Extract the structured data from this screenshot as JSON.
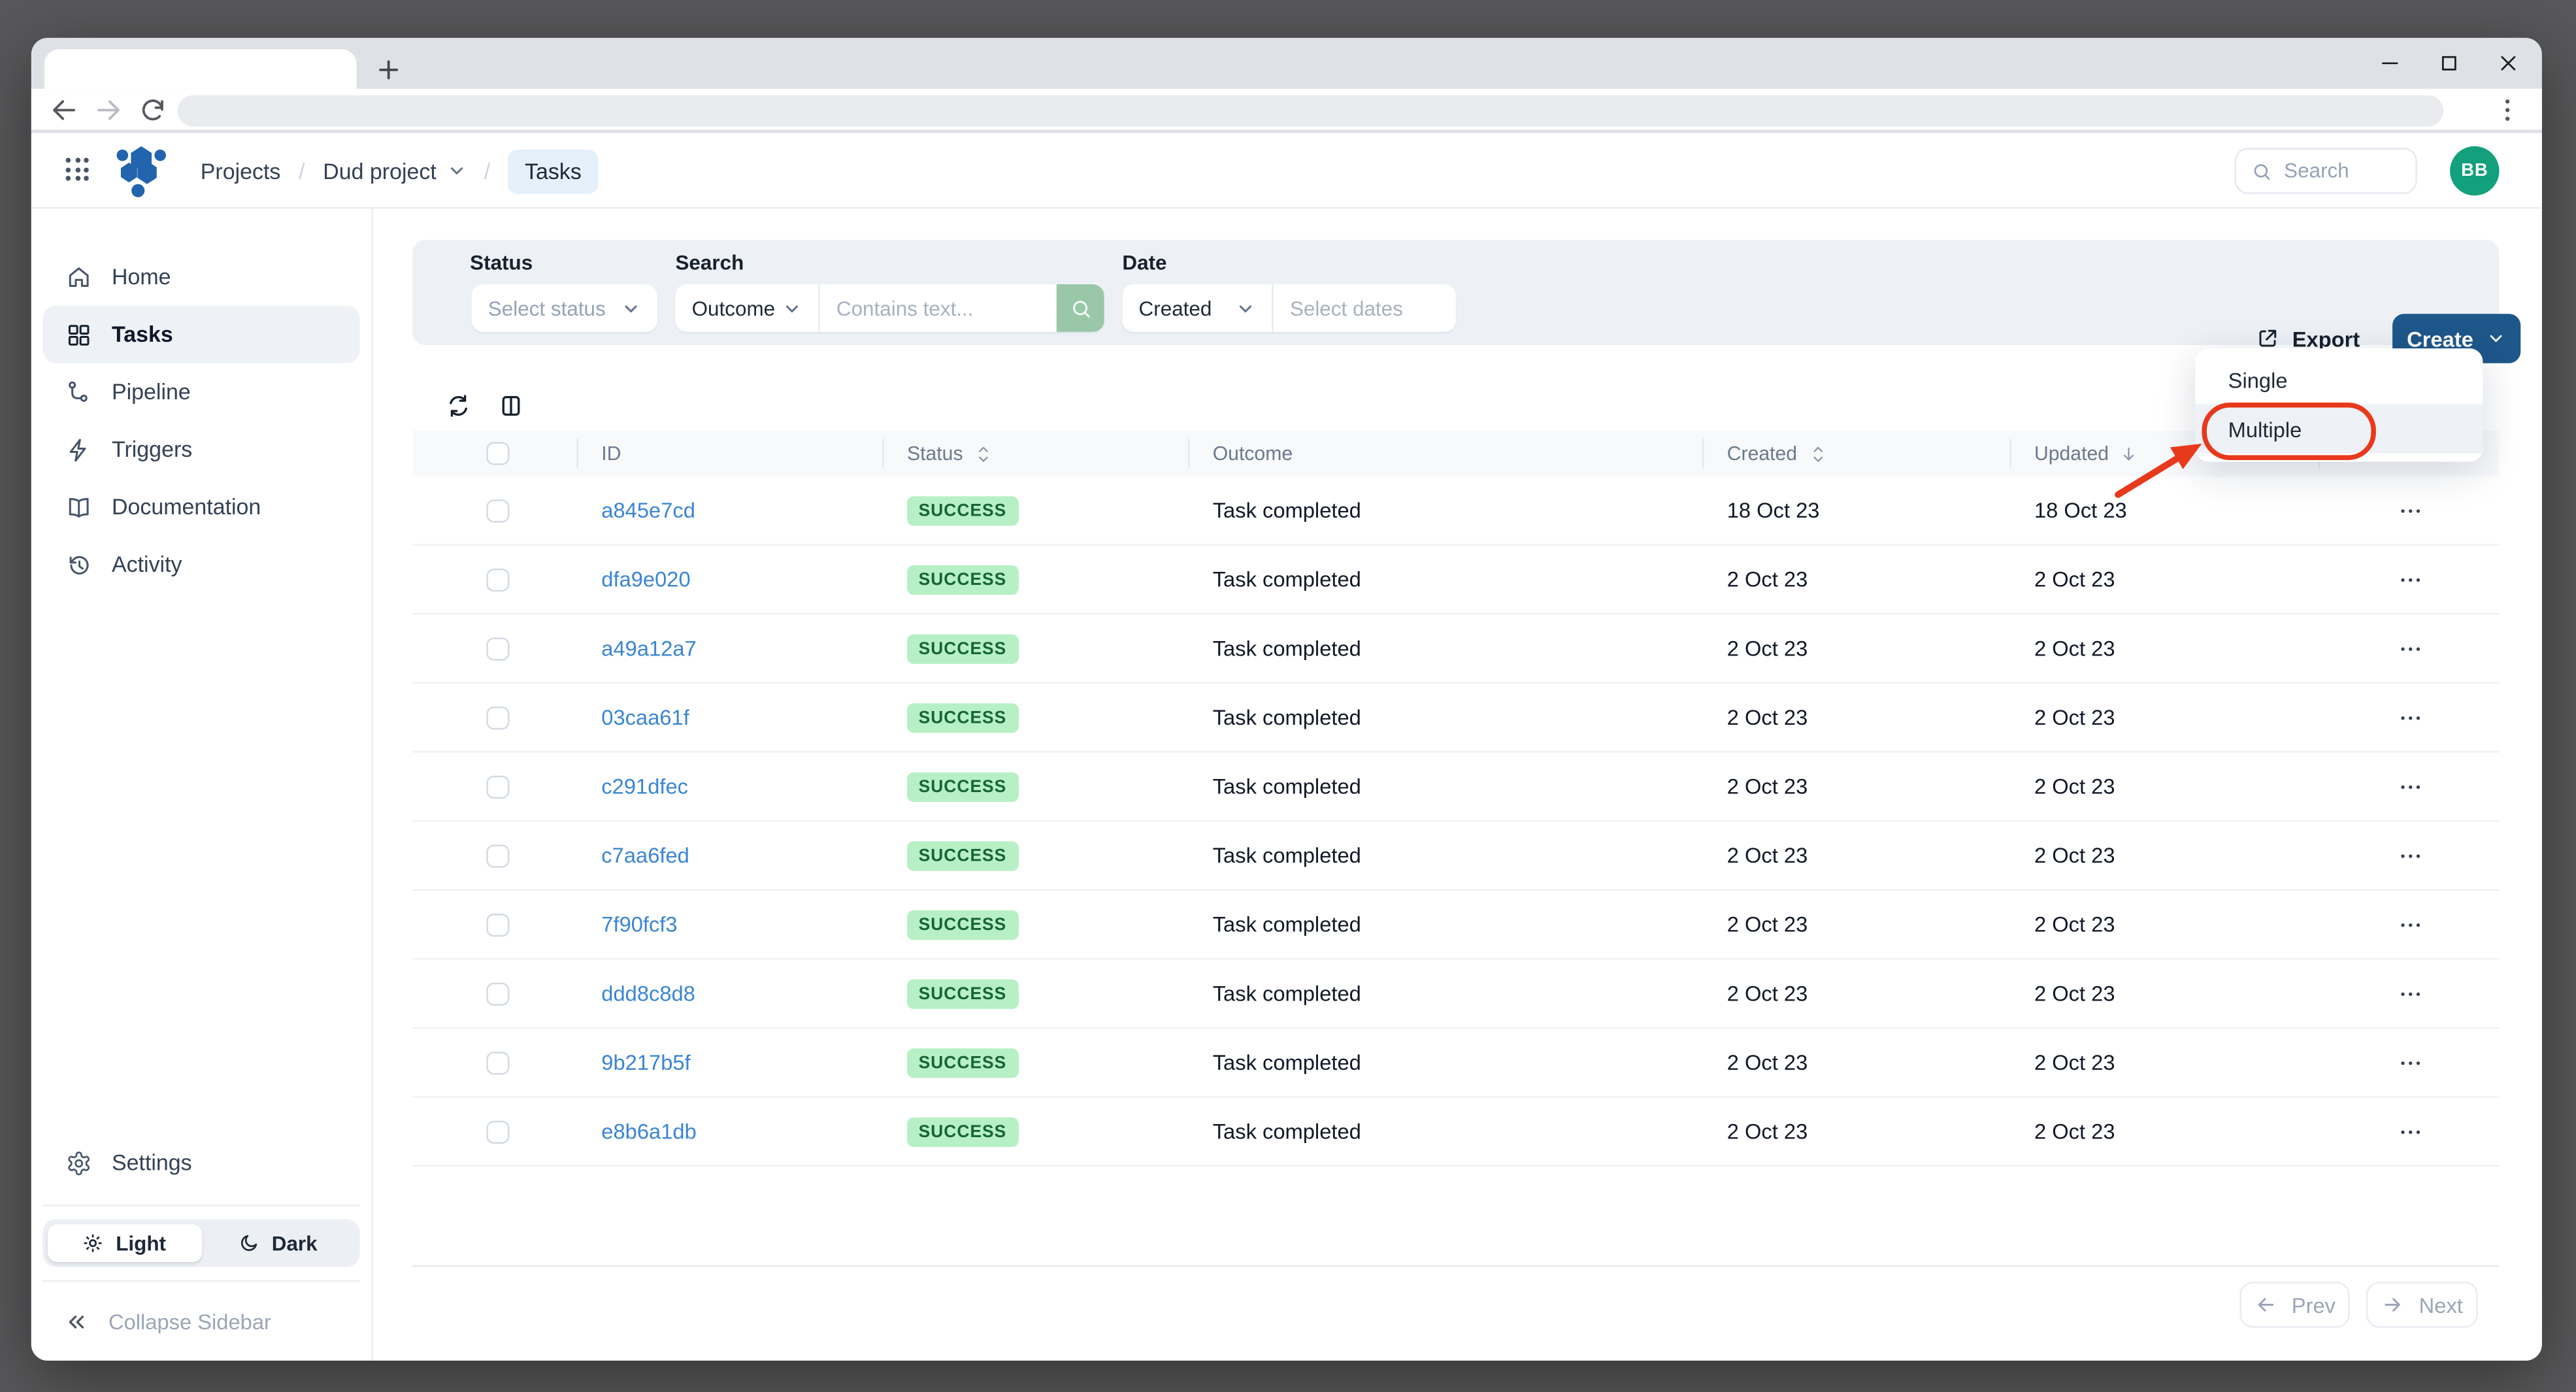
{
  "header": {
    "breadcrumb": {
      "items": [
        "Projects",
        "Dud project",
        "Tasks"
      ],
      "separator": "/"
    },
    "search_placeholder": "Search",
    "avatar_initials": "BB"
  },
  "sidebar": {
    "items": [
      {
        "label": "Home"
      },
      {
        "label": "Tasks"
      },
      {
        "label": "Pipeline"
      },
      {
        "label": "Triggers"
      },
      {
        "label": "Documentation"
      },
      {
        "label": "Activity"
      }
    ],
    "active_item": "Tasks",
    "settings_label": "Settings",
    "theme": {
      "light_label": "Light",
      "dark_label": "Dark",
      "active": "Light"
    },
    "collapse_label": "Collapse Sidebar"
  },
  "filters": {
    "status": {
      "label": "Status",
      "placeholder": "Select status"
    },
    "search": {
      "label": "Search",
      "field": "Outcome",
      "placeholder": "Contains text..."
    },
    "date": {
      "label": "Date",
      "field": "Created",
      "placeholder": "Select dates"
    }
  },
  "actions": {
    "export_label": "Export",
    "create_label": "Create",
    "create_menu": {
      "options": [
        "Single",
        "Multiple"
      ],
      "highlighted": "Multiple"
    }
  },
  "table": {
    "columns": {
      "id": "ID",
      "status": "Status",
      "outcome": "Outcome",
      "created": "Created",
      "updated": "Updated"
    },
    "sort": {
      "status": "sortable",
      "created": "sortable",
      "updated": "descending"
    },
    "rows": [
      {
        "id": "a845e7cd",
        "status": "SUCCESS",
        "outcome": "Task completed",
        "created": "18 Oct 23",
        "updated": "18 Oct 23"
      },
      {
        "id": "dfa9e020",
        "status": "SUCCESS",
        "outcome": "Task completed",
        "created": "2 Oct 23",
        "updated": "2 Oct 23"
      },
      {
        "id": "a49a12a7",
        "status": "SUCCESS",
        "outcome": "Task completed",
        "created": "2 Oct 23",
        "updated": "2 Oct 23"
      },
      {
        "id": "03caa61f",
        "status": "SUCCESS",
        "outcome": "Task completed",
        "created": "2 Oct 23",
        "updated": "2 Oct 23"
      },
      {
        "id": "c291dfec",
        "status": "SUCCESS",
        "outcome": "Task completed",
        "created": "2 Oct 23",
        "updated": "2 Oct 23"
      },
      {
        "id": "c7aa6fed",
        "status": "SUCCESS",
        "outcome": "Task completed",
        "created": "2 Oct 23",
        "updated": "2 Oct 23"
      },
      {
        "id": "7f90fcf3",
        "status": "SUCCESS",
        "outcome": "Task completed",
        "created": "2 Oct 23",
        "updated": "2 Oct 23"
      },
      {
        "id": "ddd8c8d8",
        "status": "SUCCESS",
        "outcome": "Task completed",
        "created": "2 Oct 23",
        "updated": "2 Oct 23"
      },
      {
        "id": "9b217b5f",
        "status": "SUCCESS",
        "outcome": "Task completed",
        "created": "2 Oct 23",
        "updated": "2 Oct 23"
      },
      {
        "id": "e8b6a1db",
        "status": "SUCCESS",
        "outcome": "Task completed",
        "created": "2 Oct 23",
        "updated": "2 Oct 23"
      }
    ]
  },
  "pagination": {
    "prev_label": "Prev",
    "next_label": "Next"
  },
  "colors": {
    "accent_blue": "#1e578a",
    "link_blue": "#3a85d4",
    "logo_blue": "#2364ae",
    "success_bg": "#b8f0c5",
    "success_text": "#166534",
    "annotation_red": "#e8391c",
    "avatar_green": "#13a07c",
    "panel_bg": "#edf1f6",
    "search_button_green": "#9ac7a7"
  }
}
